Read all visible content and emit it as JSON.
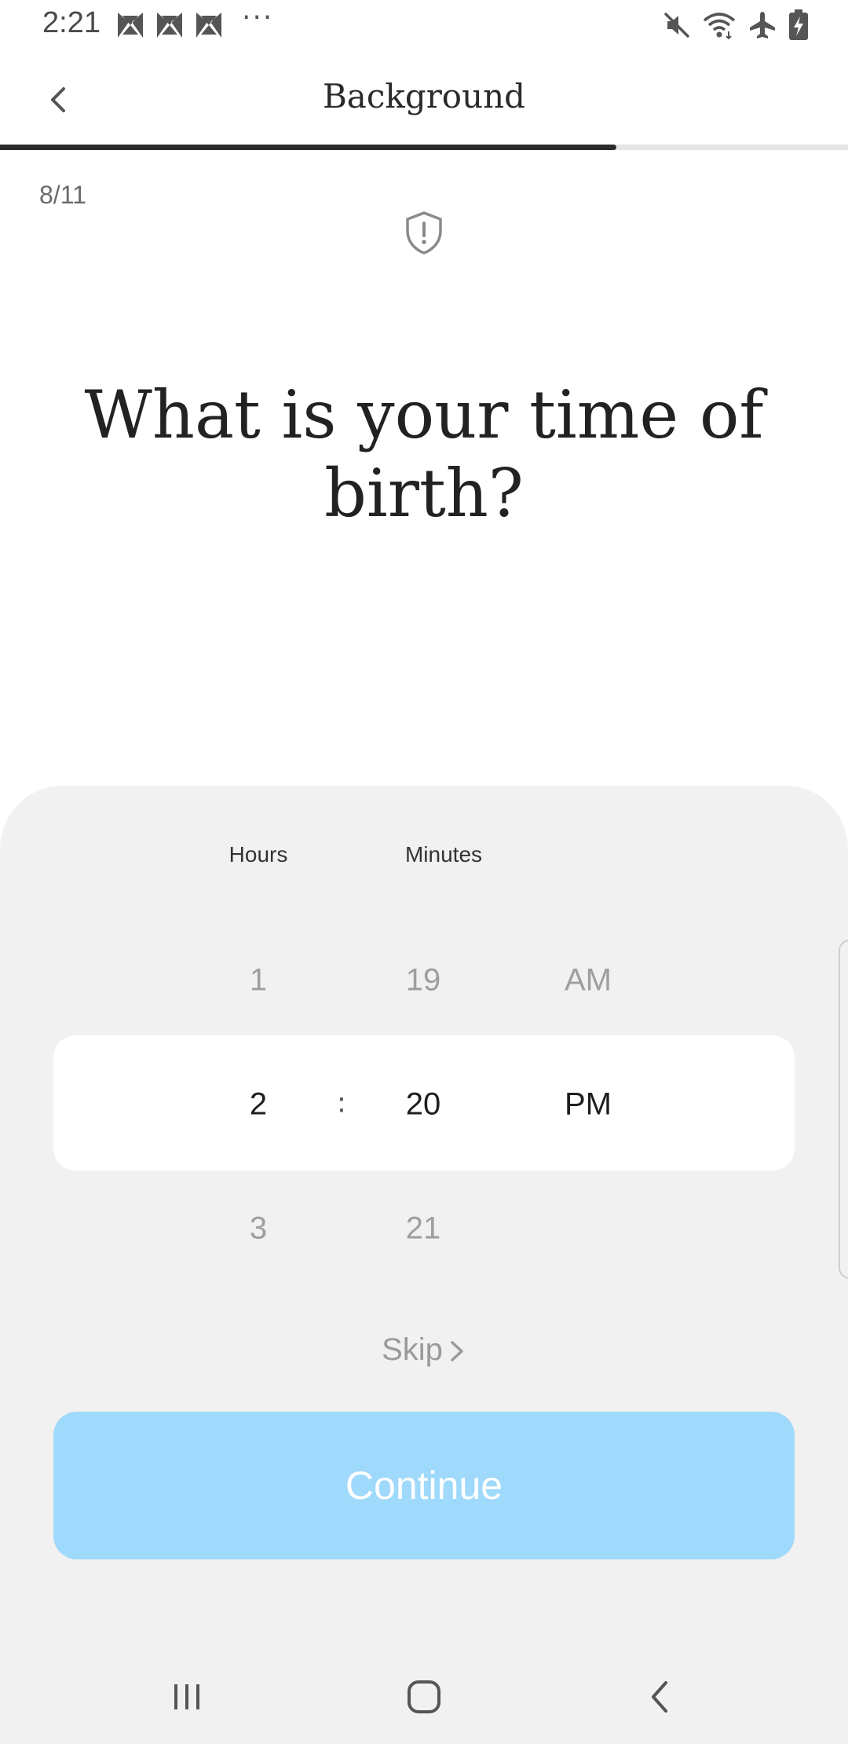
{
  "status_bar": {
    "time": "2:21",
    "overflow": "···",
    "notification_icons": [
      "app-notification-icon",
      "app-notification-icon",
      "app-notification-icon"
    ],
    "right_icons": [
      "mute-icon",
      "wifi-icon",
      "airplane-mode-icon",
      "battery-charging-icon"
    ]
  },
  "app_bar": {
    "title": "Background",
    "back_icon": "chevron-left-icon"
  },
  "progress": {
    "current": 8,
    "total": 11,
    "label": "8/11",
    "fill_fraction": 0.727
  },
  "privacy_icon": "shield-alert-icon",
  "question": "What is your time of birth?",
  "picker": {
    "headers": {
      "hours": "Hours",
      "minutes": "Minutes"
    },
    "separator": ":",
    "hours": {
      "prev": "1",
      "selected": "2",
      "next": "3"
    },
    "minutes": {
      "prev": "19",
      "selected": "20",
      "next": "21"
    },
    "period": {
      "prev": "AM",
      "selected": "PM"
    }
  },
  "skip_label": "Skip",
  "continue_label": "Continue",
  "colors": {
    "continue_button": "#9fd9fb",
    "sheet_background": "#f1f1f1",
    "progress_fill": "#2b2b2b",
    "progress_track": "#e6e6e6"
  },
  "nav_bar": {
    "recents_icon": "recent-apps-icon",
    "home_icon": "home-icon",
    "back_icon": "back-icon"
  }
}
